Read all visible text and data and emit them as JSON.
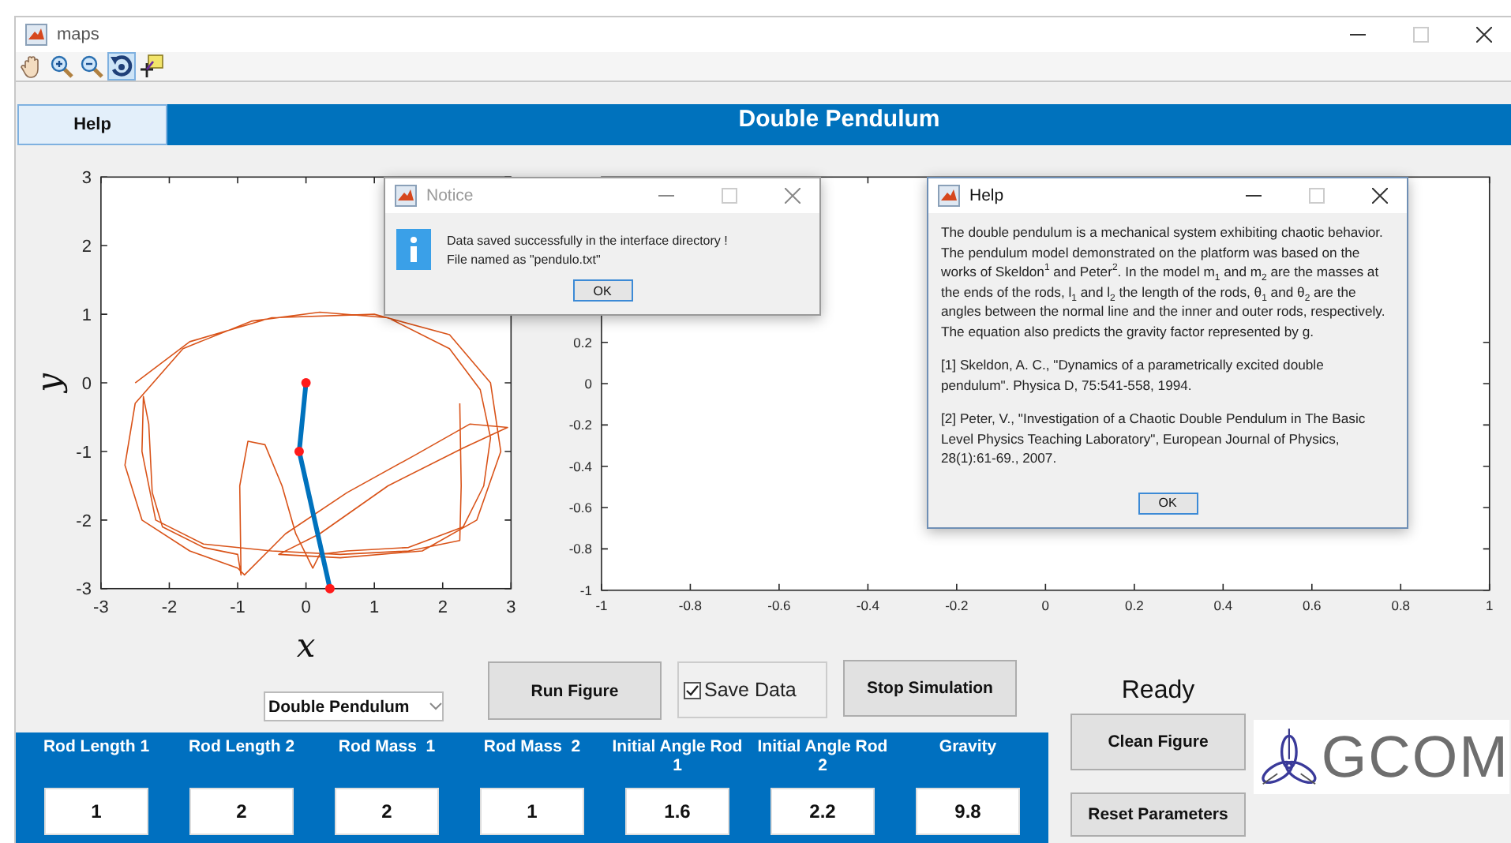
{
  "window": {
    "title": "maps"
  },
  "toolbar": {
    "tools": [
      {
        "kind": "pan",
        "selected": false
      },
      {
        "kind": "zoom_in",
        "selected": false
      },
      {
        "kind": "zoom_out",
        "selected": false
      },
      {
        "kind": "rotate",
        "selected": true
      },
      {
        "kind": "data_cursor",
        "selected": false
      }
    ]
  },
  "help_button": {
    "label": "Help"
  },
  "header": {
    "title": "Double Pendulum"
  },
  "plots": [
    {
      "chart_data": {
        "type": "line",
        "xlabel": "x",
        "ylabel": "y",
        "xlim": [
          -3,
          3
        ],
        "ylim": [
          -3,
          3
        ],
        "xticks": [
          -3,
          -2,
          -1,
          0,
          1,
          2,
          3
        ],
        "yticks": [
          -3,
          -2,
          -1,
          0,
          1,
          2,
          3
        ],
        "series": [
          {
            "color": "#d95319",
            "x": [
              2.25,
              2.27,
              2.25,
              1.5,
              0.5,
              -0.5,
              -1.5,
              -2.2,
              -2.4,
              -2.38,
              -2.3,
              -2.25,
              -2.1,
              -1.5,
              -1.0,
              -0.95,
              -0.97,
              -0.85,
              -0.6,
              -0.35,
              -0.15,
              0.1,
              0.2,
              0.6,
              1.5,
              2.3,
              2.6,
              2.7,
              2.55,
              2.1,
              1.2,
              0.2,
              -0.8,
              -1.8,
              -2.5,
              -2.65,
              -2.4,
              -1.7,
              -1.0,
              -0.9,
              -0.3,
              0.6,
              1.6,
              2.4,
              2.95,
              2.3,
              1.2,
              0.2,
              -0.4,
              0.5,
              1.7,
              2.5,
              2.85,
              2.7,
              2.1,
              1.0,
              -0.5,
              -1.7,
              -2.5
            ],
            "values": [
              -0.3,
              -1.5,
              -2.3,
              -2.45,
              -2.5,
              -2.45,
              -2.35,
              -2.0,
              -1.0,
              -0.2,
              -0.6,
              -1.6,
              -2.1,
              -2.4,
              -2.5,
              -2.8,
              -1.5,
              -0.85,
              -0.9,
              -1.5,
              -2.2,
              -2.7,
              -2.5,
              -2.45,
              -2.4,
              -2.1,
              -1.5,
              -0.8,
              -0.1,
              0.5,
              0.95,
              1.03,
              0.9,
              0.5,
              -0.3,
              -1.2,
              -2.0,
              -2.45,
              -2.7,
              -2.8,
              -2.2,
              -1.6,
              -1.05,
              -0.6,
              -0.65,
              -0.95,
              -1.5,
              -2.2,
              -2.5,
              -2.55,
              -2.45,
              -2.0,
              -1.0,
              0.0,
              0.7,
              1.0,
              0.95,
              0.6,
              0.0
            ]
          },
          {
            "color": "#0072bd",
            "marker": "o",
            "x": [
              0,
              -0.1,
              0.35
            ],
            "values": [
              0,
              -1,
              -3
            ]
          }
        ]
      }
    },
    {
      "chart_data": {
        "type": "line",
        "xlim": [
          -1,
          1
        ],
        "ylim": [
          -1,
          1
        ],
        "xticks": [
          -1,
          -0.8,
          -0.6,
          -0.4,
          -0.2,
          0,
          0.2,
          0.4,
          0.6,
          0.8,
          1
        ],
        "yticks": [
          -1,
          -0.8,
          -0.6,
          -0.4,
          -0.2,
          0,
          0.2
        ]
      }
    }
  ],
  "controls": {
    "model_dropdown": {
      "value": "Double Pendulum"
    },
    "run_button": {
      "label": "Run Figure"
    },
    "save_checkbox": {
      "label": "Save Data",
      "checked": true
    },
    "stop_button": {
      "label": "Stop Simulation"
    },
    "status": "Ready",
    "clean_button": {
      "label": "Clean Figure"
    },
    "reset_button": {
      "label": "Reset Parameters"
    }
  },
  "parameters": [
    {
      "label": "Rod Length 1",
      "value": "1"
    },
    {
      "label": "Rod Length 2",
      "value": "2"
    },
    {
      "label": "Rod Mass  1",
      "value": "2"
    },
    {
      "label": "Rod Mass  2",
      "value": "1"
    },
    {
      "label": "Initial Angle Rod 1",
      "value": "1.6"
    },
    {
      "label": "Initial Angle Rod 2",
      "value": "2.2"
    },
    {
      "label": "Gravity",
      "value": "9.8"
    }
  ],
  "logo": {
    "text": "GCOM"
  },
  "dialogs": [
    {
      "kind": "notice",
      "title": "Notice",
      "active": false,
      "message_lines": [
        "Data saved successfully in the interface directory !",
        "File named as \"pendulo.txt\""
      ],
      "button": "OK"
    },
    {
      "kind": "help",
      "title": "Help",
      "active": true,
      "paragraphs": [
        "The double pendulum is a mechanical system exhibiting chaotic behavior. The pendulum model demonstrated on the platform was based on the works of Skeldon$^{1}$ and Peter$^{2}$. In the model m$_{1}$ and m$_{2}$ are the masses at the ends of the rods, l$_{1}$ and l$_{2}$ the length of the rods, θ$_{1}$ and θ$_{2}$ are the angles between the normal line and the inner and outer rods, respectively. The equation also predicts the gravity factor represented by g.",
        "[1] Skeldon, A. C., \"Dynamics of a parametrically excited double pendulum\". Physica D, 75:541-558, 1994.",
        "[2] Peter, V., \"Investigation of a Chaotic Double Pendulum in The Basic Level Physics Teaching Laboratory\", European Journal of Physics, 28(1):61-69., 2007."
      ],
      "button": "OK"
    }
  ]
}
